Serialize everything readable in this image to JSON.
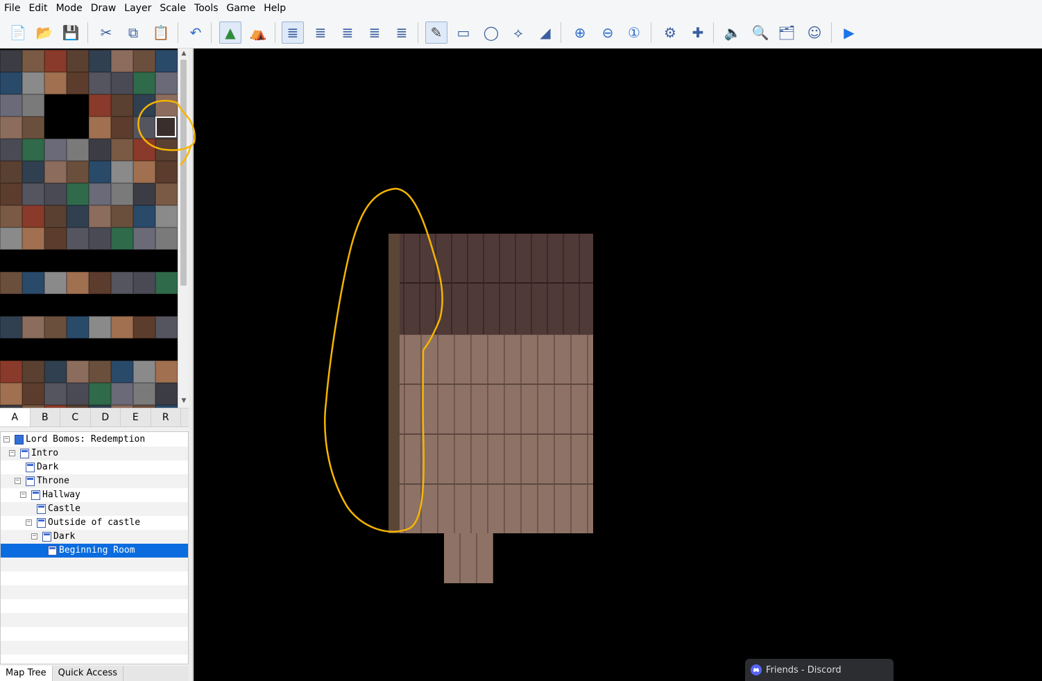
{
  "menu": [
    "File",
    "Edit",
    "Mode",
    "Draw",
    "Layer",
    "Scale",
    "Tools",
    "Game",
    "Help"
  ],
  "toolbar": {
    "buttons": [
      {
        "name": "new-project-icon"
      },
      {
        "name": "open-project-icon"
      },
      {
        "name": "save-project-icon"
      },
      {
        "name": "cut-icon"
      },
      {
        "name": "copy-icon"
      },
      {
        "name": "paste-icon"
      },
      {
        "name": "undo-icon"
      },
      {
        "name": "map-mode-icon"
      },
      {
        "name": "event-mode-icon"
      },
      {
        "name": "layer-1-icon"
      },
      {
        "name": "layer-2-icon"
      },
      {
        "name": "layer-3-icon"
      },
      {
        "name": "layer-4-icon"
      },
      {
        "name": "layer-5-icon"
      },
      {
        "name": "pencil-icon"
      },
      {
        "name": "rectangle-icon"
      },
      {
        "name": "ellipse-icon"
      },
      {
        "name": "fill-icon"
      },
      {
        "name": "shadow-pen-icon"
      },
      {
        "name": "zoom-in-icon"
      },
      {
        "name": "zoom-out-icon"
      },
      {
        "name": "actual-size-icon"
      },
      {
        "name": "database-icon"
      },
      {
        "name": "plugin-manager-icon"
      },
      {
        "name": "sound-test-icon"
      },
      {
        "name": "event-searcher-icon"
      },
      {
        "name": "resource-manager-icon"
      },
      {
        "name": "character-generator-icon"
      },
      {
        "name": "playtest-icon"
      }
    ],
    "active": [
      "map-mode-icon",
      "layer-1-icon",
      "pencil-icon"
    ]
  },
  "tileset_tabs": [
    "A",
    "B",
    "C",
    "D",
    "E",
    "R"
  ],
  "tileset_active_tab": "A",
  "map_tree": [
    {
      "label": "Lord Bomos: Redemption",
      "depth": 0,
      "toggle": "⊟",
      "project": true
    },
    {
      "label": "Intro",
      "depth": 1,
      "toggle": "⊟"
    },
    {
      "label": "Dark",
      "depth": 2,
      "toggle": ""
    },
    {
      "label": "Throne",
      "depth": 2,
      "toggle": "⊟"
    },
    {
      "label": "Hallway",
      "depth": 3,
      "toggle": "⊟"
    },
    {
      "label": "Castle",
      "depth": 4,
      "toggle": ""
    },
    {
      "label": "Outside of castle",
      "depth": 4,
      "toggle": "⊟"
    },
    {
      "label": "Dark",
      "depth": 5,
      "toggle": "⊟"
    },
    {
      "label": "Beginning Room",
      "depth": 6,
      "toggle": "",
      "selected": true
    }
  ],
  "bottom_tabs": [
    "Map Tree",
    "Quick Access"
  ],
  "bottom_active": "Map Tree",
  "discord": {
    "label": "Friends - Discord"
  },
  "colors": {
    "selection": "#0a6cde",
    "annotation": "#f7b500",
    "canvas": "#000000"
  }
}
